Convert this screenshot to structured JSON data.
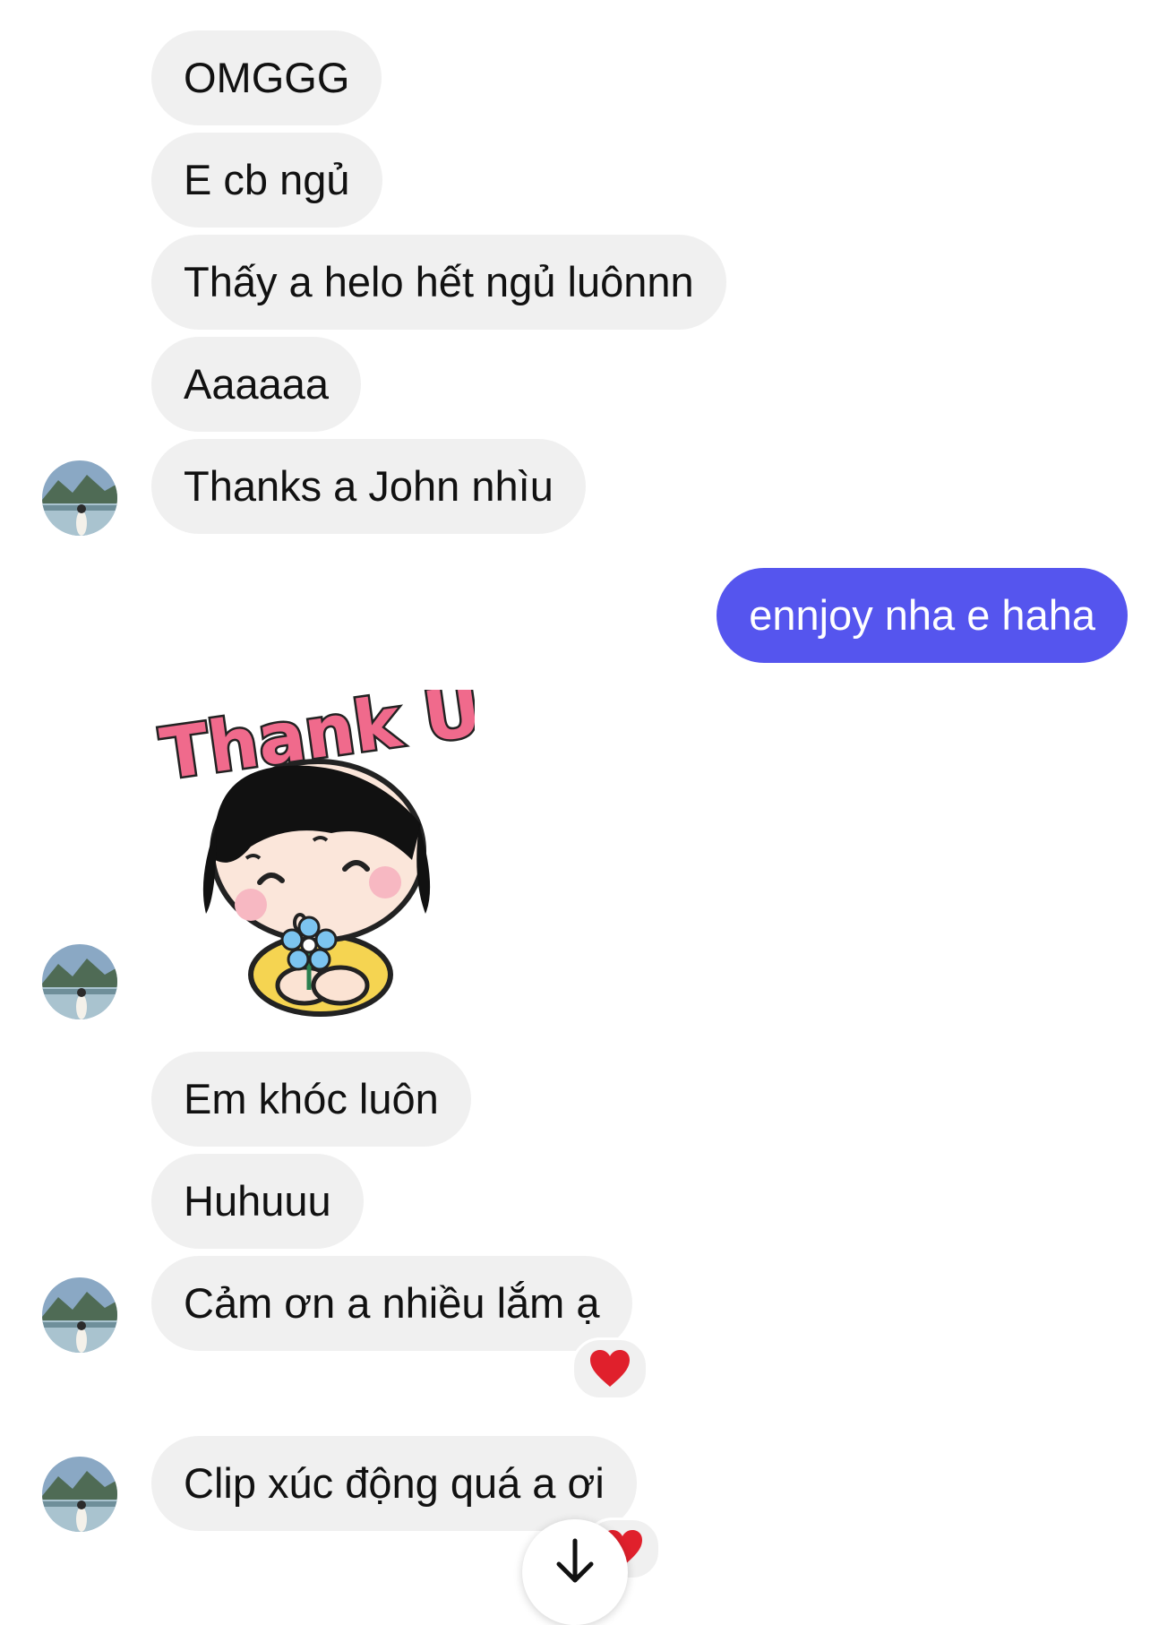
{
  "messages": {
    "m1": "OMGGG",
    "m2": "E cb ngủ",
    "m3": "Thấy a helo hết ngủ luônnn",
    "m4": "Aaaaaa",
    "m5": "Thanks a John nhìu",
    "m6": "ennjoy nha e haha",
    "m7": "Em khóc luôn",
    "m8": "Huhuuu",
    "m9": "Cảm ơn a nhiều lắm ạ",
    "m10": "Clip xúc động quá a ơi"
  },
  "sticker": {
    "text": "Thank U"
  },
  "reactions": {
    "r1": "heart",
    "r2": "heart"
  },
  "icons": {
    "avatar": "profile-photo-lake",
    "scroll": "arrow-down-icon",
    "reaction": "heart-icon"
  },
  "colors": {
    "incoming_bubble": "#f0f0f0",
    "outgoing_bubble": "#5555ee",
    "heart": "#e0202c"
  }
}
